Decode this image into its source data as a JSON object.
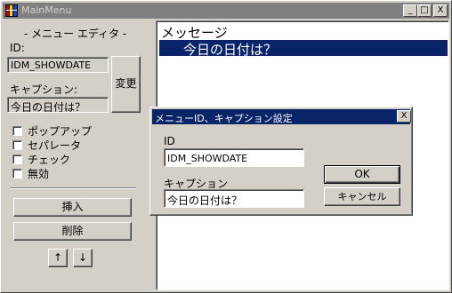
{
  "window": {
    "title": "MainMenu",
    "minimize": "_",
    "maximize": "□",
    "close": "X"
  },
  "left_panel": {
    "group_title": "- メニュー エディタ -",
    "id_label": "ID:",
    "id_value": "IDM_SHOWDATE",
    "caption_label": "キャプション:",
    "caption_value": "今日の日付は？",
    "change_button": "変更",
    "checkboxes": [
      "ポップアップ",
      "セパレータ",
      "チェック",
      "無効"
    ],
    "insert_button": "挿入",
    "delete_button": "削除",
    "up_button": "↑",
    "down_button": "↓"
  },
  "menu_list": {
    "items": [
      "メッセージ",
      "今日の日付は？"
    ],
    "selected_index": 1
  },
  "dialog": {
    "title": "メニューID、キャプション設定",
    "close": "X",
    "id_label": "ID",
    "id_value": "IDM_SHOWDATE",
    "caption_label": "キャプション",
    "caption_value": "今日の日付は？",
    "ok_button": "OK",
    "cancel_button": "キャンセル"
  },
  "colors": {
    "selection": "#0a246a",
    "face": "#d4d0c8",
    "inactive_title": "#808080"
  }
}
